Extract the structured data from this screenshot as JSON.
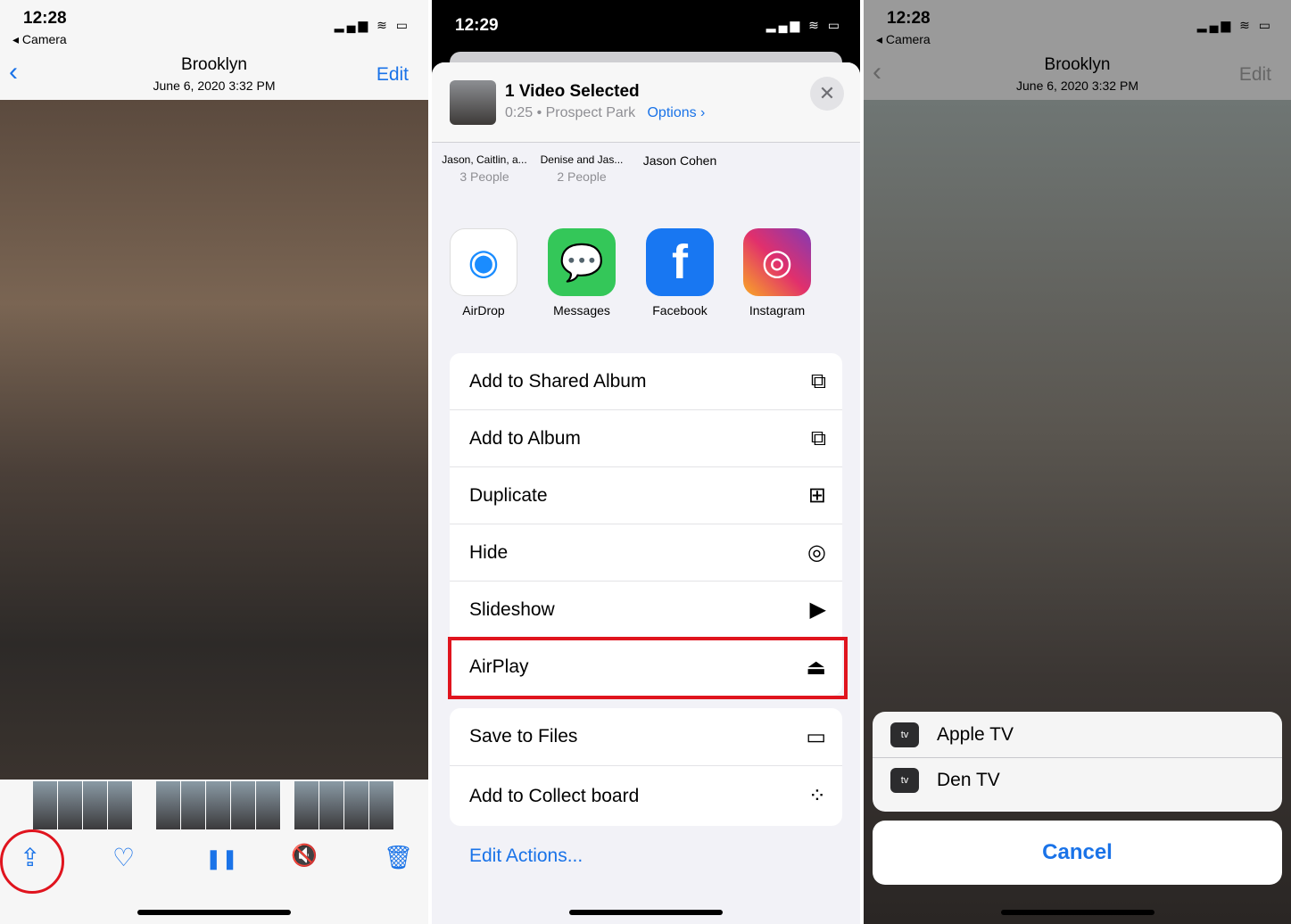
{
  "left": {
    "time": "12:28",
    "back_app": "◂ Camera",
    "status_icons": "▂▄▆ ≋ ▭",
    "title": "Brooklyn",
    "subtitle": "June 6, 2020  3:32 PM",
    "back": "‹",
    "edit": "Edit",
    "toolbar": {
      "share": "⇪",
      "favorite": "♡",
      "pause": "❚❚",
      "mute": "🔇",
      "delete": "🗑"
    }
  },
  "middle": {
    "time": "12:29",
    "status_icons": "▂▄▆ ≋ ▭",
    "header": {
      "title": "1 Video Selected",
      "duration": "0:25 • Prospect Park",
      "options": "Options ›",
      "close": "✕"
    },
    "people": [
      {
        "name": "Jason, Caitlin, a...",
        "sub": "3 People"
      },
      {
        "name": "Denise and Jas...",
        "sub": "2 People"
      },
      {
        "name": "Jason Cohen",
        "sub": ""
      }
    ],
    "apps": [
      {
        "label": "AirDrop",
        "icon": "airdrop-icon",
        "color": "#ffffff"
      },
      {
        "label": "Messages",
        "icon": "messages-icon",
        "color": "#34c759"
      },
      {
        "label": "Facebook",
        "icon": "facebook-icon",
        "color": "#1877f2"
      },
      {
        "label": "Instagram",
        "icon": "instagram-icon",
        "color": "#d62976"
      }
    ],
    "actions": [
      {
        "label": "Add to Shared Album",
        "icon": "⧉"
      },
      {
        "label": "Add to Album",
        "icon": "⧉"
      },
      {
        "label": "Duplicate",
        "icon": "⊞"
      },
      {
        "label": "Hide",
        "icon": "◎"
      },
      {
        "label": "Slideshow",
        "icon": "▶"
      },
      {
        "label": "AirPlay",
        "icon": "⏏"
      }
    ],
    "actions2": [
      {
        "label": "Save to Files",
        "icon": "▭"
      },
      {
        "label": "Add to Collect board",
        "icon": "⁘"
      }
    ],
    "edit_actions": "Edit Actions..."
  },
  "right": {
    "time": "12:28",
    "back_app": "◂ Camera",
    "status_icons": "▂▄▆ ≋ ▭",
    "title": "Brooklyn",
    "subtitle": "June 6, 2020  3:32 PM",
    "back": "‹",
    "edit": "Edit",
    "devices": [
      {
        "label": "Apple TV",
        "icon": "tv"
      },
      {
        "label": "Den TV",
        "icon": "tv"
      }
    ],
    "cancel": "Cancel"
  },
  "colors": {
    "accent": "#1a73e8",
    "highlight": "#e0141e"
  }
}
